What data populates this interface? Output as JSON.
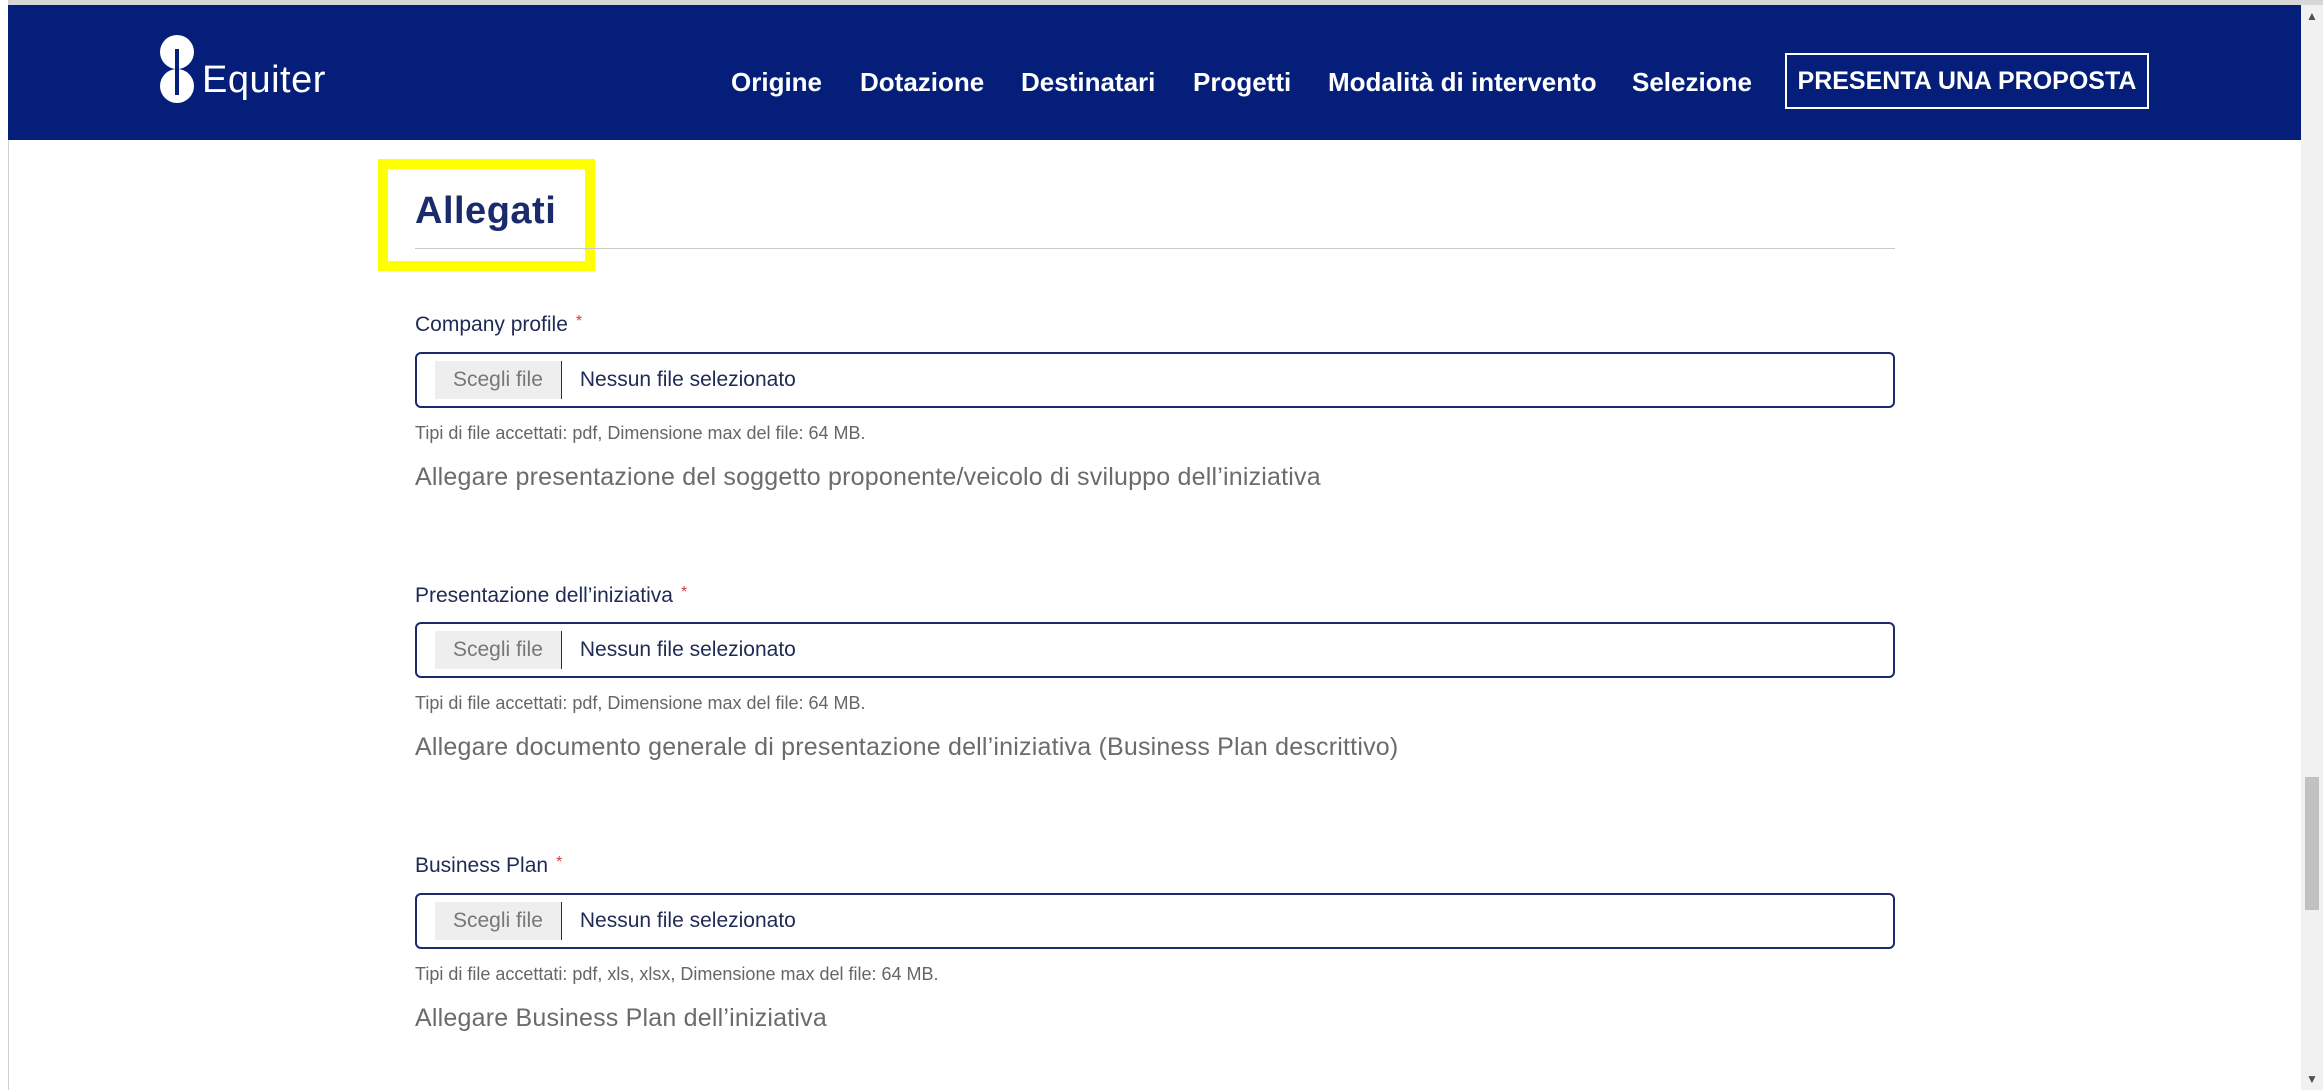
{
  "brand": {
    "name": "Equiter"
  },
  "nav": {
    "items": [
      {
        "label": "Origine"
      },
      {
        "label": "Dotazione"
      },
      {
        "label": "Destinatari"
      },
      {
        "label": "Progetti"
      },
      {
        "label": "Modalità di intervento"
      },
      {
        "label": "Selezione"
      }
    ],
    "cta": "PRESENTA UNA PROPOSTA"
  },
  "section": {
    "title": "Allegati"
  },
  "fields": [
    {
      "label": "Company profile",
      "required_marker": "*",
      "button": "Scegli file",
      "status": "Nessun file selezionato",
      "hint": "Tipi di file accettati: pdf, Dimensione max del file: 64 MB.",
      "description": "Allegare presentazione del soggetto proponente/veicolo di sviluppo dell’iniziativa"
    },
    {
      "label": "Presentazione dell’iniziativa",
      "required_marker": "*",
      "button": "Scegli file",
      "status": "Nessun file selezionato",
      "hint": "Tipi di file accettati: pdf, Dimensione max del file: 64 MB.",
      "description": "Allegare documento generale di presentazione dell’iniziativa (Business Plan descrittivo)"
    },
    {
      "label": "Business Plan",
      "required_marker": "*",
      "button": "Scegli file",
      "status": "Nessun file selezionato",
      "hint": "Tipi di file accettati: pdf, xls, xlsx, Dimensione max del file: 64 MB.",
      "description": "Allegare Business Plan dell’iniziativa"
    }
  ],
  "colors": {
    "header_bg": "#041e7a",
    "highlight": "#ffff00",
    "required": "#e03a3a"
  },
  "icons": {
    "logo": "equiter-logo-icon",
    "scroll_up": "scroll-up-arrow-icon",
    "scroll_down": "scroll-down-arrow-icon"
  }
}
